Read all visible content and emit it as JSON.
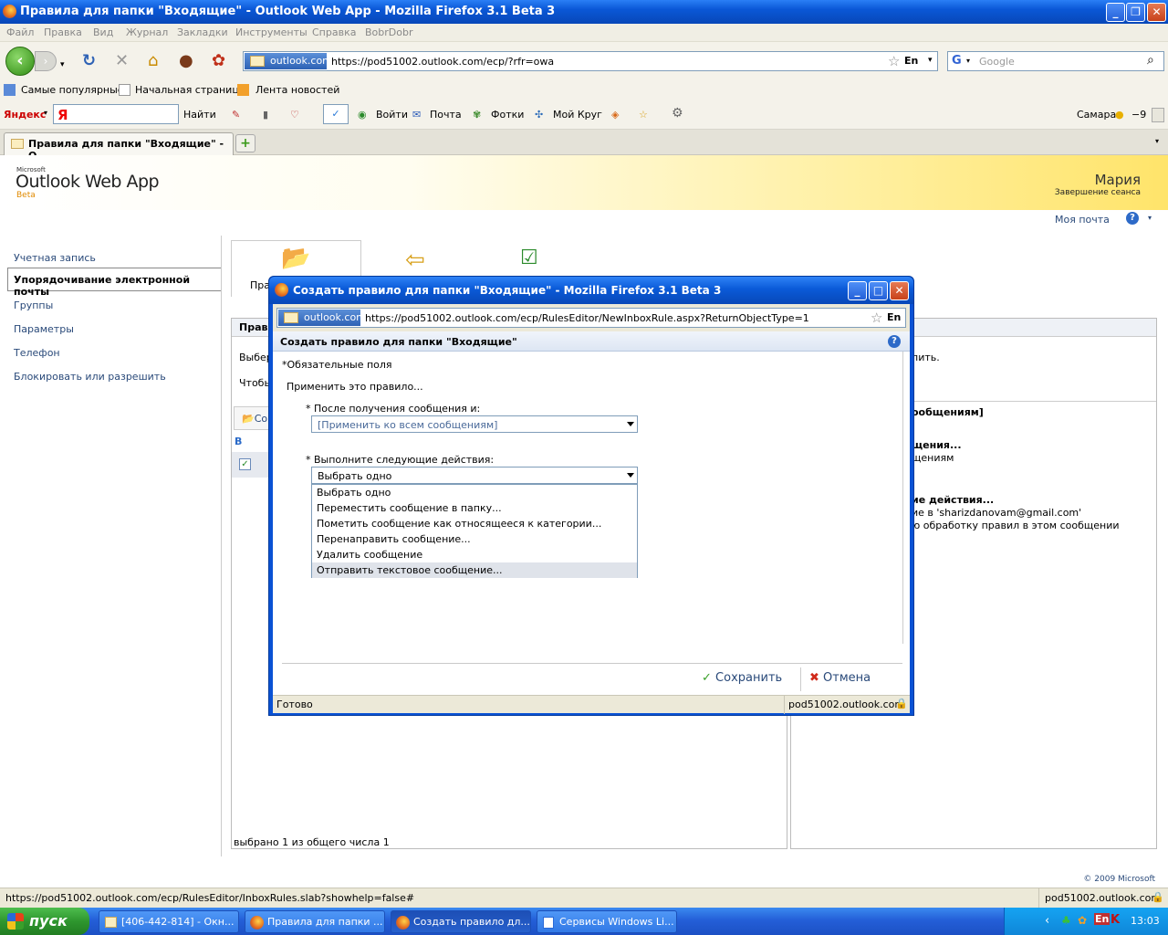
{
  "window": {
    "title": "Правила для папки \"Входящие\" - Outlook Web App - Mozilla Firefox 3.1 Beta 3"
  },
  "menu": [
    "Файл",
    "Правка",
    "Вид",
    "Журнал",
    "Закладки",
    "Инструменты",
    "Справка",
    "BobrDobr"
  ],
  "nav": {
    "site": "outlook.com",
    "url": "https://pod51002.outlook.com/ecp/?rfr=owa",
    "lang": "En",
    "search_placeholder": "Google"
  },
  "bookmarks": [
    "Самые популярные",
    "Начальная страница",
    "Лента новостей"
  ],
  "yandex": {
    "brand": "Яндекс",
    "logo": "Я",
    "find": "Найти",
    "login": "Войти",
    "mail": "Почта",
    "photos": "Фотки",
    "circle": "Мой Круг",
    "city": "Самара",
    "temp": "−9"
  },
  "tab": {
    "label": "Правила для папки \"Входящие\" - О..."
  },
  "owa": {
    "microsoft": "Microsoft",
    "title": "Outlook Web App",
    "beta": "Beta",
    "user": "Мария",
    "logout": "Завершение сеанса",
    "mymail": "Моя почта",
    "nav": [
      "Учетная запись",
      "Упорядочивание электронной почты",
      "Группы",
      "Параметры",
      "Телефон",
      "Блокировать или разрешить"
    ],
    "tool_label": "Пра",
    "panel_head": "Прави",
    "bg": {
      "l1": "Выбер",
      "l2": "Чтобы",
      "tb": "Со",
      "col": "В",
      "r1": "пить.",
      "r2": "ообщениям]",
      "r3": "щения...",
      "r4": "щениям",
      "r5": "ие действия...",
      "r6": "ие в 'sharizdanovam@gmail.com'",
      "r7": "ю обработку правил в этом сообщении"
    },
    "status": "выбрано 1 из общего числа 1",
    "copyright": "© 2009 Microsoft"
  },
  "popup": {
    "title": "Создать правило для папки \"Входящие\" - Mozilla Firefox 3.1 Beta 3",
    "site": "outlook.com",
    "url": "https://pod51002.outlook.com/ecp/RulesEditor/NewInboxRule.aspx?ReturnObjectType=1",
    "lang": "En",
    "header": "Создать правило для папки \"Входящие\"",
    "required": "*Обязательные поля",
    "apply": "Применить это правило...",
    "cond_label": "* После получения сообщения и:",
    "cond_value": "[Применить ко всем сообщениям]",
    "action_label": "* Выполните следующие действия:",
    "action_value": "Выбрать одно",
    "options": [
      "Выбрать одно",
      "Переместить сообщение в папку...",
      "Пометить сообщение как относящееся к категории...",
      "Перенаправить сообщение...",
      "Удалить сообщение",
      "Отправить текстовое сообщение..."
    ],
    "save": "Сохранить",
    "cancel": "Отмена",
    "status_left": "Готово",
    "status_right": "pod51002.outlook.com"
  },
  "statusbar": {
    "url": "https://pod51002.outlook.com/ecp/RulesEditor/InboxRules.slab?showhelp=false#",
    "host": "pod51002.outlook.com"
  },
  "taskbar": {
    "start": "пуск",
    "items": [
      "[406-442-814] - Окн...",
      "Правила для папки ...",
      "Создать правило дл...",
      "Сервисы Windows Li..."
    ],
    "lang": "EN",
    "tray_lang": "En",
    "clock": "13:03"
  },
  "colors": {
    "titlebar": "#0a57d6",
    "accent": "#2a4a7a",
    "taskbar": "#245fd8",
    "start": "#2e962e"
  }
}
